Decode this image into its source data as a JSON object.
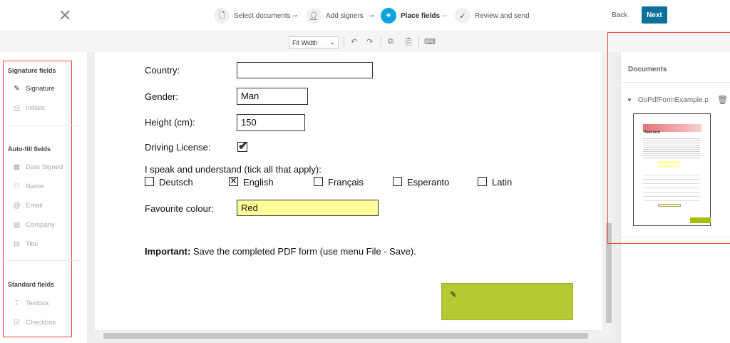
{
  "header": {
    "steps": [
      {
        "label": "Select documents"
      },
      {
        "label": "Add signers"
      },
      {
        "label": "Place fields"
      },
      {
        "label": "Review and send"
      }
    ],
    "back_label": "Back",
    "next_label": "Next"
  },
  "toolbar": {
    "zoom": "Fit Width"
  },
  "sidebar": {
    "sections": [
      {
        "title": "Signature fields",
        "items": [
          {
            "label": "Signature"
          },
          {
            "label": "Initials"
          }
        ]
      },
      {
        "title": "Auto-fill fields",
        "items": [
          {
            "label": "Date Signed"
          },
          {
            "label": "Name"
          },
          {
            "label": "Email"
          },
          {
            "label": "Company"
          },
          {
            "label": "Title"
          }
        ]
      },
      {
        "title": "Standard fields",
        "items": [
          {
            "label": "Textbox"
          },
          {
            "label": "Checkbox"
          }
        ]
      }
    ]
  },
  "document": {
    "country_label": "Country:",
    "country_value": "",
    "gender_label": "Gender:",
    "gender_value": "Man",
    "height_label": "Height (cm):",
    "height_value": "150",
    "license_label": "Driving License:",
    "languages_label": "I speak and understand (tick all that apply):",
    "languages": [
      {
        "label": "Deutsch",
        "checked": false
      },
      {
        "label": "English",
        "checked": true
      },
      {
        "label": "Français",
        "checked": false
      },
      {
        "label": "Esperanto",
        "checked": false
      },
      {
        "label": "Latin",
        "checked": false
      }
    ],
    "colour_label": "Favourite colour:",
    "colour_value": "Red",
    "important_bold": "Important:",
    "important_text": " Save the completed PDF form (use menu File - Save)."
  },
  "documents_panel": {
    "title": "Documents",
    "file_name": "OoPdfFormExample.p",
    "thumb_logo": "foerson"
  },
  "colors": {
    "accent": "#0aa3dd",
    "next": "#0d7199",
    "signature_field": "#b5c934",
    "form_fill": "#ffff99"
  }
}
